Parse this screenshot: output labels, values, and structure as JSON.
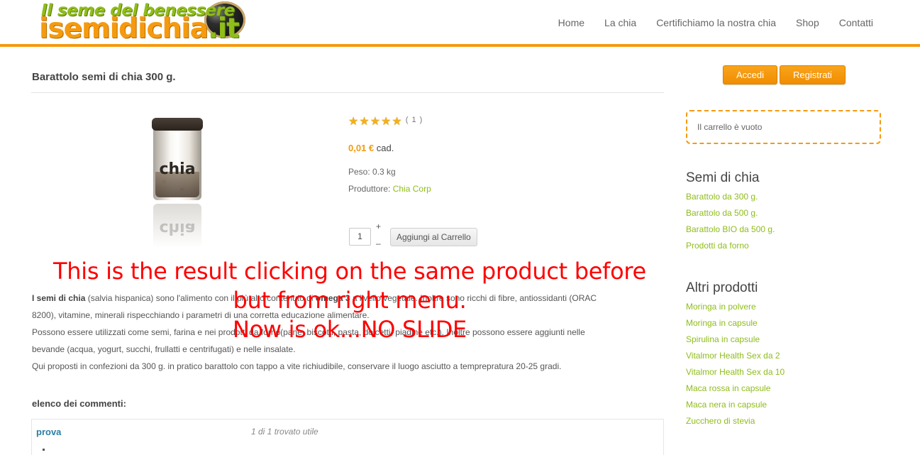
{
  "header": {
    "logo_tagline": "Il seme del benessere",
    "logo_brand": "isemidichia",
    "logo_tld": ".it",
    "nav": [
      "Home",
      "La chia",
      "Certifichiamo la nostra chia",
      "Shop",
      "Contatti"
    ]
  },
  "product": {
    "title": "Barattolo semi di chia 300 g.",
    "image_label": "chia",
    "rating_stars": 5,
    "rating_count": "( 1 )",
    "price": "0,01 €",
    "price_unit": "cad.",
    "weight": "Peso: 0.3 kg",
    "producer_label": "Produttore:",
    "producer_name": "Chia Corp",
    "quantity": "1",
    "plus": "+",
    "minus": "–",
    "add_to_cart": "Aggiungi al Carrello"
  },
  "description": {
    "line1_bold": "I semi di chia",
    "line1_a": " (salvia hispanica) sono l'alimento con il più alto contenuto di ",
    "line1_bold2": "omega 3",
    "line1_b": " a livello vegetale. Inoltre sono ricchi di fibre, antiossidanti (ORAC",
    "line2": "8200), vitamine, minerali rispecchiando i parametri di una corretta educazione alimentare.",
    "line3": "Possono essere utilizzati come semi, farina e nei prodotti da forno(pane, biscotti, pasta, dolcetti, piadine etc.). Inoltre possono essere aggiunti nelle",
    "line4": "bevande (acqua, yogurt, succhi, frullatti e centrifugati) e nelle insalate.",
    "line5": "Qui proposti in confezioni da 300 g. in pratico barattolo con tappo a vite richiudibile, conservare il luogo asciutto a temprepratura 20-25 gradi."
  },
  "comments": {
    "title": "elenco dei commenti:",
    "author": "prova",
    "useful": "1 di 1 trovato utile"
  },
  "sidebar": {
    "login": "Accedi",
    "register": "Registrati",
    "cart_empty": "Il carrello è vuoto",
    "section1_title": "Semi di chia",
    "section1_items": [
      "Barattolo da 300 g.",
      "Barattolo da 500 g.",
      "Barattolo BIO da 500 g.",
      "Prodotti da forno"
    ],
    "section2_title": "Altri prodotti",
    "section2_items": [
      "Moringa in polvere",
      "Moringa in capsule",
      "Spirulina in capsule",
      "Vitalmor Health Sex da 2",
      "Vitalmor Health Sex da 10",
      "Maca rossa in capsule",
      "Maca nera in capsule",
      "Zucchero di stevia"
    ]
  },
  "annotation": {
    "line1": "This is the result clicking on the same product before",
    "line2": "but from right menu.",
    "line3": "Now is ok...NO SLIDE"
  },
  "colors": {
    "accent_orange": "#f59a0f",
    "link_green": "#8fbd1a",
    "annotation_red": "#ff0000"
  }
}
